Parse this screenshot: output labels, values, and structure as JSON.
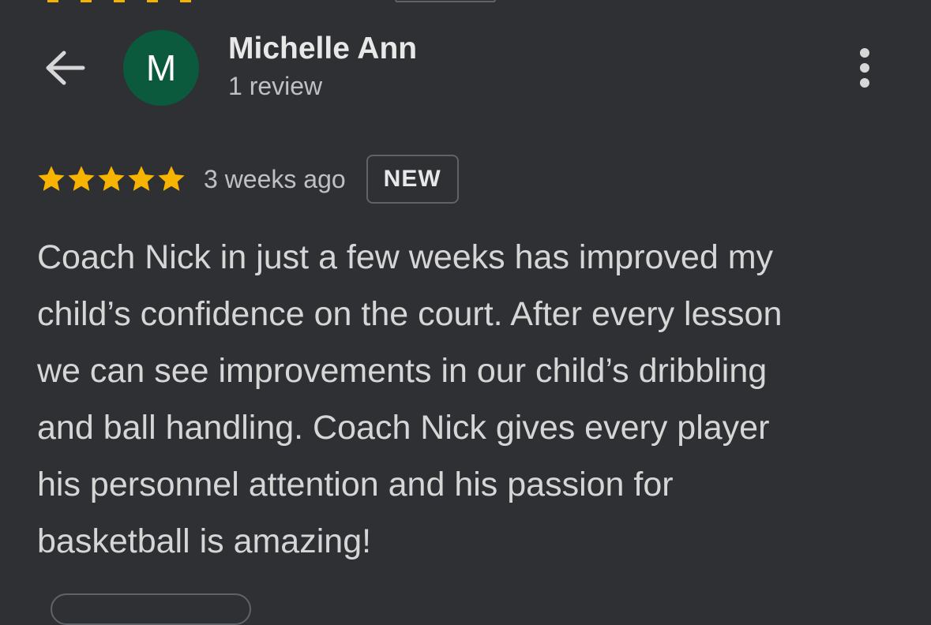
{
  "reviewer": {
    "initial": "M",
    "name": "Michelle Ann",
    "review_count": "1 review",
    "avatar_color": "#0b5a3e"
  },
  "review": {
    "stars": 5,
    "star_color": "#f6b400",
    "time_ago": "3 weeks ago",
    "badge": "NEW",
    "lines": [
      "Coach Nick in just a few weeks has improved my",
      "child’s confidence on the court. After every lesson",
      "we can see improvements in our child’s dribbling",
      "and ball handling. Coach Nick gives every player",
      "his personnel attention and his passion for",
      "basketball is amazing!"
    ]
  },
  "icons": {
    "back": "arrow-back-icon",
    "more": "more-vert-icon",
    "star": "star-icon"
  }
}
